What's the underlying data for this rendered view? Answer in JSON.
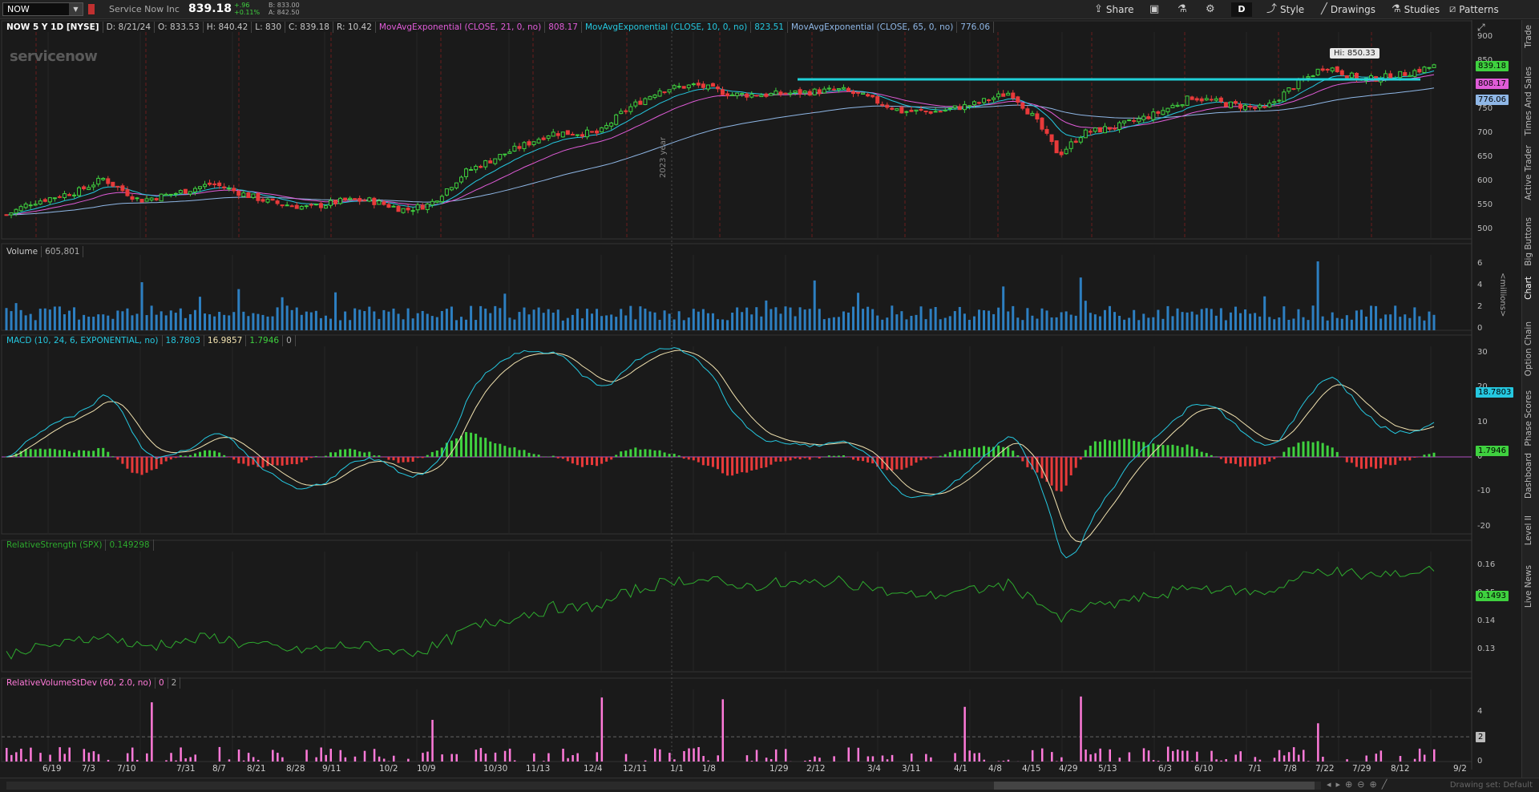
{
  "toolbar": {
    "symbol": "NOW",
    "company": "Service Now Inc",
    "price": "839.18",
    "change": "+.96",
    "change_pct": "+0.11%",
    "bid": "B: 833.00",
    "ask": "A: 842.50",
    "share_label": "Share",
    "timeframe": "D",
    "style_label": "Style",
    "drawings_label": "Drawings",
    "studies_label": "Studies",
    "patterns_label": "Patterns"
  },
  "price_pane": {
    "header": "NOW 5 Y 1D [NYSE]",
    "date": "D: 8/21/24",
    "open": "O: 833.53",
    "high": "H: 840.42",
    "low": "L: 830",
    "close": "C: 839.18",
    "range": "R: 10.42",
    "ema21_label": "MovAvgExponential (CLOSE, 21, 0, no)",
    "ema21_value": "808.17",
    "ema10_label": "MovAvgExponential (CLOSE, 10, 0, no)",
    "ema10_value": "823.51",
    "ema65_label": "MovAvgExponential (CLOSE, 65, 0, no)",
    "ema65_value": "776.06",
    "watermark": "servicenow",
    "hi_callout": "Hi: 850.33",
    "year_label": "2023 year",
    "axis_ticks": [
      "900",
      "850",
      "800",
      "750",
      "700",
      "650",
      "600",
      "550",
      "500"
    ],
    "badge_close": "839.18",
    "badge_ema21": "808.17",
    "badge_ema65": "776.06"
  },
  "volume_pane": {
    "label": "Volume",
    "value": "605,801",
    "units": "<millions>",
    "axis_ticks": [
      "6",
      "4",
      "2",
      "0"
    ]
  },
  "macd_pane": {
    "label": "MACD (10, 24, 6, EXPONENTIAL, no)",
    "value": "18.7803",
    "avg": "16.9857",
    "diff": "1.7946",
    "zero": "0",
    "axis_ticks": [
      "30",
      "20",
      "10",
      "0",
      "-10",
      "-20"
    ],
    "badge_value": "18.7803",
    "badge_diff": "1.7946"
  },
  "rs_pane": {
    "label": "RelativeStrength (SPX)",
    "value": "0.149298",
    "axis_ticks": [
      "0.16",
      "0.15",
      "0.14",
      "0.13"
    ],
    "badge_value": "0.1493"
  },
  "rv_pane": {
    "label": "RelativeVolumeStDev (60, 2.0, no)",
    "v1": "0",
    "v2": "2",
    "axis_ticks": [
      "4",
      "2",
      "0"
    ],
    "badge_value": "2"
  },
  "date_axis": [
    "6/19",
    "7/3",
    "7/10",
    "7/31",
    "8/7",
    "8/21",
    "8/28",
    "9/11",
    "10/2",
    "10/9",
    "10/30",
    "11/13",
    "12/4",
    "12/11",
    "1/1",
    "1/8",
    "1/29",
    "2/12",
    "3/4",
    "3/11",
    "4/1",
    "4/8",
    "4/15",
    "4/29",
    "5/13",
    "6/3",
    "6/10",
    "7/1",
    "7/8",
    "7/22",
    "7/29",
    "8/12",
    "9/2"
  ],
  "sidebar_tabs": [
    "Trade",
    "Times And Sales",
    "Active Trader",
    "Big Buttons",
    "Chart",
    "Option Chain",
    "Phase Scores",
    "Dashboard",
    "Level II",
    "Live News"
  ],
  "status": {
    "drawing_set": "Drawing set: Default"
  },
  "colors": {
    "up": "#3fd13f",
    "down": "#e83a3a",
    "ema10": "#25c8e0",
    "ema21": "#e05cd8",
    "ema65": "#8fb7e6",
    "volume": "#2d7fc1",
    "rs": "#2eaa2e",
    "rv": "#ff7ad9",
    "resistance": "#20d0d8"
  }
}
